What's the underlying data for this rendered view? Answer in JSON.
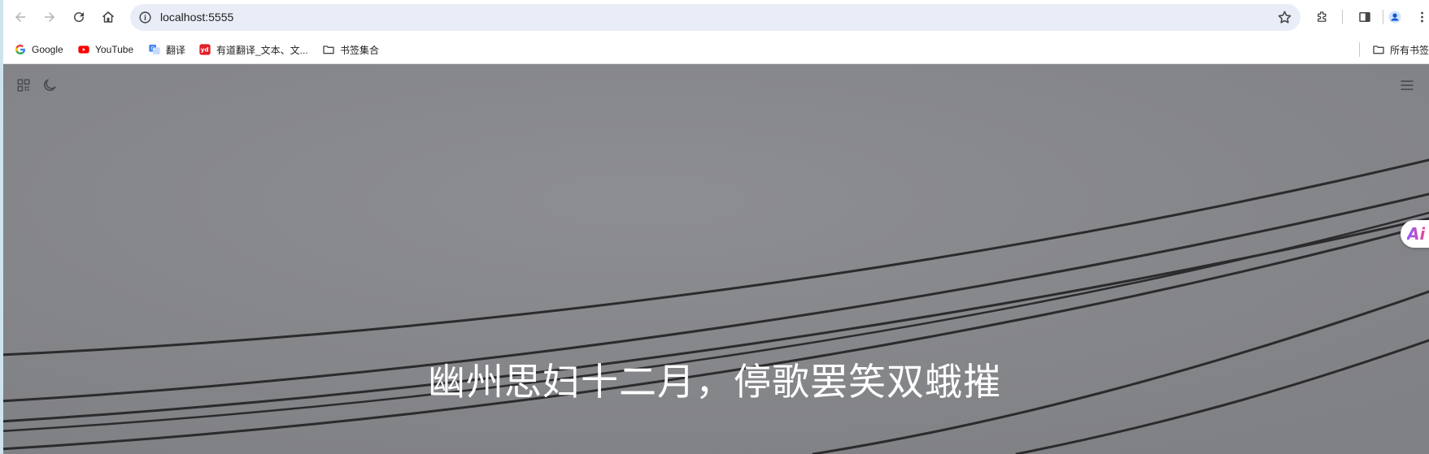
{
  "browser": {
    "url": "localhost:5555",
    "bookmarks": [
      {
        "label": "Google",
        "icon": "google-icon"
      },
      {
        "label": "YouTube",
        "icon": "youtube-icon"
      },
      {
        "label": "翻译",
        "icon": "translate-icon"
      },
      {
        "label": "有道翻译_文本、文...",
        "icon": "youdao-icon"
      },
      {
        "label": "书签集合",
        "icon": "folder-icon"
      }
    ],
    "all_bookmarks_label": "所有书签"
  },
  "page": {
    "poem_line": "幽州思妇十二月，停歌罢笑双蛾摧",
    "ai_badge": "Ai",
    "background_color": "#86878b",
    "text_color": "#ffffff"
  }
}
